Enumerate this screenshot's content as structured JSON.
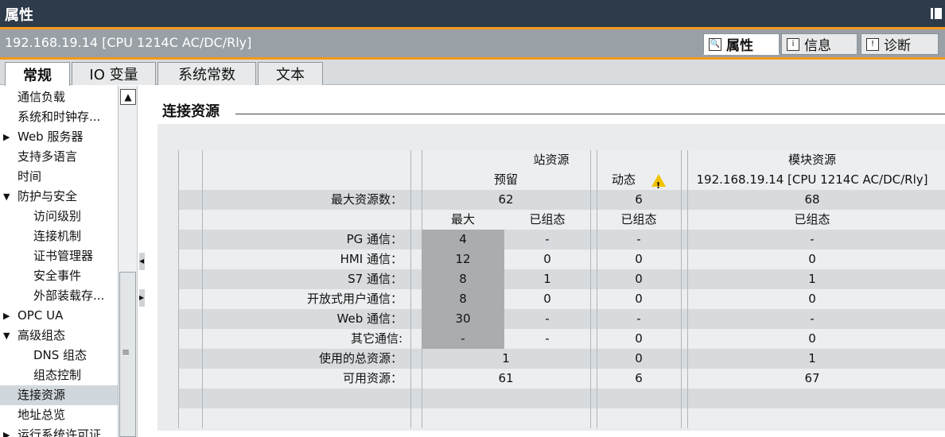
{
  "window": {
    "title": "属性"
  },
  "header": {
    "device": "192.168.19.14 [CPU 1214C AC/DC/Rly]",
    "tabs": [
      {
        "label": "属性",
        "icon": "properties-icon",
        "active": true
      },
      {
        "label": "信息",
        "icon": "info-icon",
        "active": false
      },
      {
        "label": "诊断",
        "icon": "diagnostics-icon",
        "active": false
      }
    ]
  },
  "subtabs": [
    {
      "label": "常规",
      "active": true
    },
    {
      "label": "IO 变量",
      "active": false
    },
    {
      "label": "系统常数",
      "active": false
    },
    {
      "label": "文本",
      "active": false
    }
  ],
  "nav": {
    "items": [
      {
        "label": "通信负载",
        "level": 0,
        "expander": ""
      },
      {
        "label": "系统和时钟存...",
        "level": 0,
        "expander": ""
      },
      {
        "label": "Web 服务器",
        "level": 0,
        "expander": "▶"
      },
      {
        "label": "支持多语言",
        "level": 0,
        "expander": ""
      },
      {
        "label": "时间",
        "level": 0,
        "expander": ""
      },
      {
        "label": "防护与安全",
        "level": 0,
        "expander": "▼"
      },
      {
        "label": "访问级别",
        "level": 1,
        "expander": ""
      },
      {
        "label": "连接机制",
        "level": 1,
        "expander": ""
      },
      {
        "label": "证书管理器",
        "level": 1,
        "expander": ""
      },
      {
        "label": "安全事件",
        "level": 1,
        "expander": ""
      },
      {
        "label": "外部装载存...",
        "level": 1,
        "expander": ""
      },
      {
        "label": "OPC UA",
        "level": 0,
        "expander": "▶"
      },
      {
        "label": "高级组态",
        "level": 0,
        "expander": "▼"
      },
      {
        "label": "DNS 组态",
        "level": 1,
        "expander": ""
      },
      {
        "label": "组态控制",
        "level": 1,
        "expander": ""
      },
      {
        "label": "连接资源",
        "level": 0,
        "expander": "",
        "selected": true
      },
      {
        "label": "地址总览",
        "level": 0,
        "expander": ""
      },
      {
        "label": "运行系统许可证",
        "level": 0,
        "expander": "▶"
      }
    ]
  },
  "section": {
    "title": "连接资源"
  },
  "table": {
    "group_station": "站资源",
    "group_module": "模块资源",
    "reserved": "预留",
    "dynamic": "动态",
    "module_name": "192.168.19.14 [CPU 1214C AC/DC/Rly]",
    "max_label": "最大资源数：",
    "max_reserved": "62",
    "max_dynamic": "6",
    "max_module": "68",
    "col_max": "最大",
    "col_configured": "已组态",
    "rows": [
      {
        "label": "PG 通信：",
        "max": "4",
        "res": "-",
        "dyn": "-",
        "mod": "-"
      },
      {
        "label": "HMI 通信：",
        "max": "12",
        "res": "0",
        "dyn": "0",
        "mod": "0"
      },
      {
        "label": "S7 通信：",
        "max": "8",
        "res": "1",
        "dyn": "0",
        "mod": "1"
      },
      {
        "label": "开放式用户通信：",
        "max": "8",
        "res": "0",
        "dyn": "0",
        "mod": "0"
      },
      {
        "label": "Web 通信：",
        "max": "30",
        "res": "-",
        "dyn": "-",
        "mod": "-"
      },
      {
        "label": "其它通信:",
        "max": "-",
        "res": "-",
        "dyn": "0",
        "mod": "0"
      }
    ],
    "used_label": "使用的总资源：",
    "used_reserved": "1",
    "used_dynamic": "0",
    "used_module": "1",
    "avail_label": "可用资源：",
    "avail_reserved": "61",
    "avail_dynamic": "6",
    "avail_module": "67"
  },
  "colors": {
    "titlebar": "#2e3b4b",
    "accent": "#f29a1a",
    "headbar": "#9aa1a6",
    "maxcell": "#a9adb0"
  }
}
